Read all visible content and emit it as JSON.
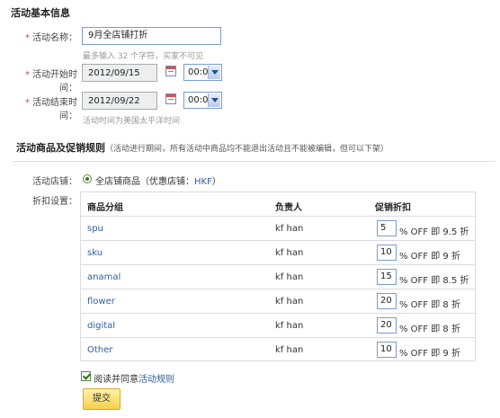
{
  "basic": {
    "title": "活动基本信息",
    "name_label": "活动名称：",
    "name_value": "9月全店铺打折",
    "name_hint": "最多输入 32 个字符，买家不可见",
    "start_label": "活动开始时间：",
    "start_date": "2012/09/15",
    "start_time": "00:00",
    "end_label": "活动结束时间：",
    "end_date": "2012/09/22",
    "end_time": "00:00",
    "time_hint": "活动时间为美国太平洋时间",
    "required_mark": "*"
  },
  "rules": {
    "title": "活动商品及促销规则",
    "note": "（活动进行期间，所有活动中商品均不能退出活动且不能被编辑，但可以下架）",
    "store_label": "活动店铺：",
    "store_option_prefix": "全店铺商品（优惠店铺：",
    "store_code": "HKF",
    "store_option_suffix": "）",
    "discount_label": "折扣设置：",
    "table": {
      "headers": [
        "商品分组",
        "负责人",
        "促销折扣"
      ],
      "rows": [
        {
          "group": "spu",
          "owner": "kf han",
          "discount": "5",
          "suffix": "% OFF 即 9.5 折"
        },
        {
          "group": "sku",
          "owner": "kf han",
          "discount": "10",
          "suffix": "% OFF 即 9 折"
        },
        {
          "group": "anamal",
          "owner": "kf han",
          "discount": "15",
          "suffix": "% OFF 即 8.5 折"
        },
        {
          "group": "flower",
          "owner": "kf han",
          "discount": "20",
          "suffix": "% OFF 即 8 折"
        },
        {
          "group": "digital",
          "owner": "kf han",
          "discount": "20",
          "suffix": "% OFF 即 8 折"
        },
        {
          "group": "Other",
          "owner": "kf han",
          "discount": "10",
          "suffix": "% OFF 即 9 折"
        }
      ]
    }
  },
  "agreement": {
    "text": "阅读并同意",
    "link": "活动规则",
    "checked": true
  },
  "submit_label": "提交"
}
